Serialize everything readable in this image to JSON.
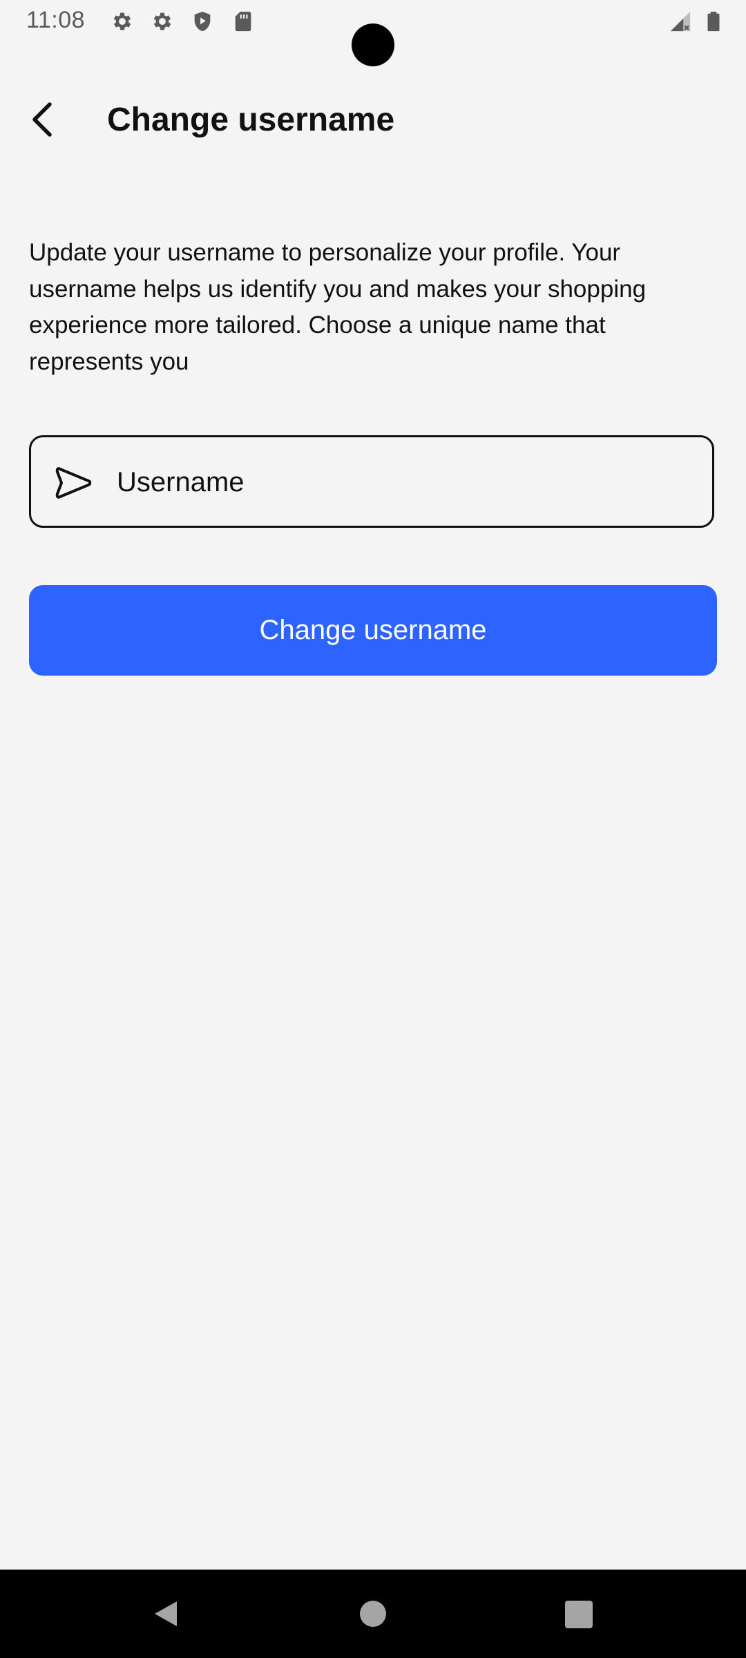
{
  "status_bar": {
    "time": "11:08",
    "icons": [
      "gear-icon",
      "gear-icon",
      "shield-play-icon",
      "sd-card-icon",
      "signal-icon",
      "battery-icon"
    ]
  },
  "header": {
    "title": "Change username",
    "back_icon": "chevron-left-icon"
  },
  "main": {
    "description": "Update your username to personalize your profile. Your username helps us identify you and makes your shopping experience more tailored. Choose a unique name that represents you",
    "username_field": {
      "placeholder": "Username",
      "value": "",
      "icon": "send-icon"
    },
    "submit_label": "Change username"
  },
  "nav_bar": {
    "icons": [
      "nav-back-icon",
      "nav-home-icon",
      "nav-recents-icon"
    ]
  },
  "colors": {
    "background": "#f4f4f4",
    "accent": "#2d63ff",
    "text": "#111111"
  }
}
